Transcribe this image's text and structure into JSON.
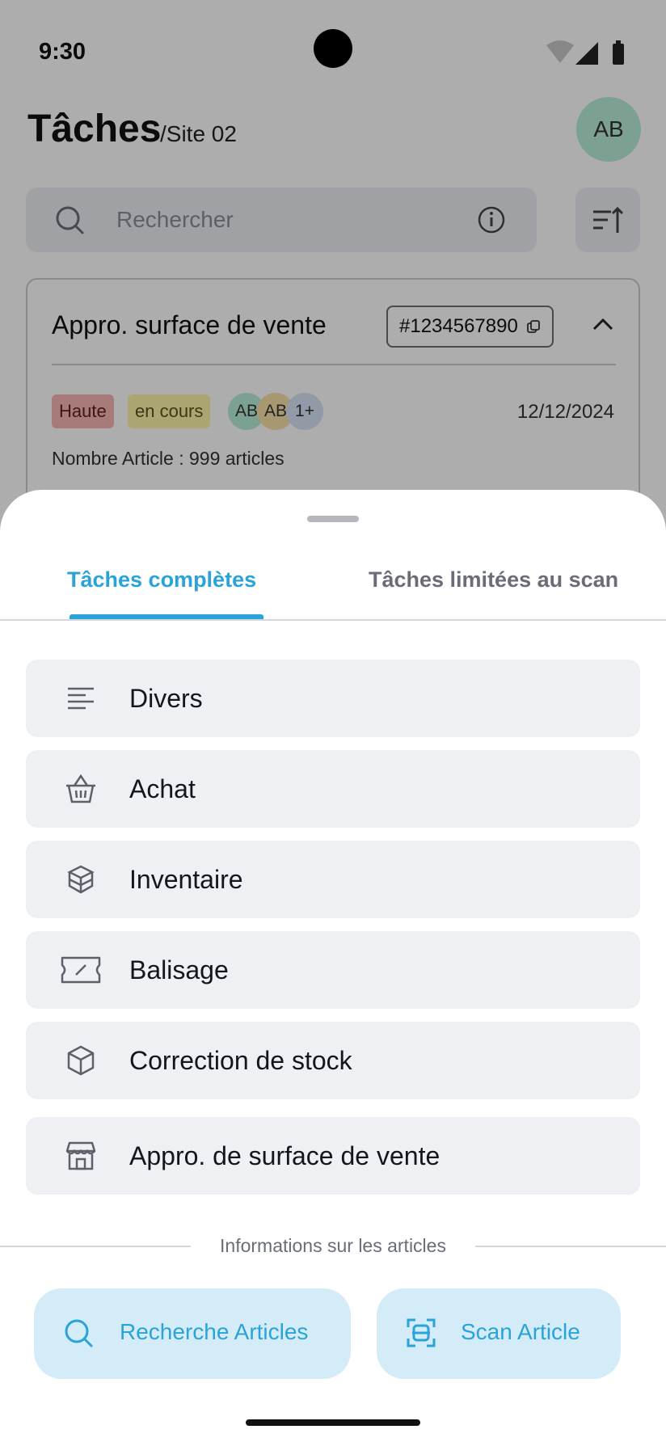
{
  "status_bar": {
    "time": "9:30"
  },
  "header": {
    "title": "Tâches",
    "subtitle": "/Site 02",
    "avatar_initials": "AB"
  },
  "search": {
    "placeholder": "Rechercher",
    "icon": "search-icon",
    "info_icon": "info-icon",
    "sort_icon": "sort-icon"
  },
  "task_card": {
    "title": "Appro. surface de vente",
    "id": "#1234567890",
    "priority": "Haute",
    "status": "en cours",
    "assignees": [
      "AB",
      "AB",
      "1+"
    ],
    "date": "12/12/2024",
    "article_count": "Nombre Article : 999 articles",
    "colors": {
      "priority": "#f8b4b4",
      "status": "#fdf3a8"
    }
  },
  "sheet": {
    "tabs": [
      {
        "label": "Tâches complètes",
        "active": true
      },
      {
        "label": "Tâches limitées au scan",
        "active": false
      }
    ],
    "options": [
      {
        "label": "Divers",
        "icon": "lines-icon"
      },
      {
        "label": "Achat",
        "icon": "basket-icon"
      },
      {
        "label": "Inventaire",
        "icon": "boxes-icon"
      },
      {
        "label": "Balisage",
        "icon": "ticket-icon"
      },
      {
        "label": "Correction de stock",
        "icon": "box-icon"
      },
      {
        "label": "Appro. de surface de vente",
        "icon": "store-icon"
      }
    ],
    "section_label": "Informations sur les articles",
    "actions": {
      "search_label": "Recherche Articles",
      "scan_label": "Scan Article"
    }
  },
  "colors": {
    "accent": "#2aa3d8",
    "accent_bg": "#d3ecf8",
    "option_bg": "#eff0f3"
  }
}
